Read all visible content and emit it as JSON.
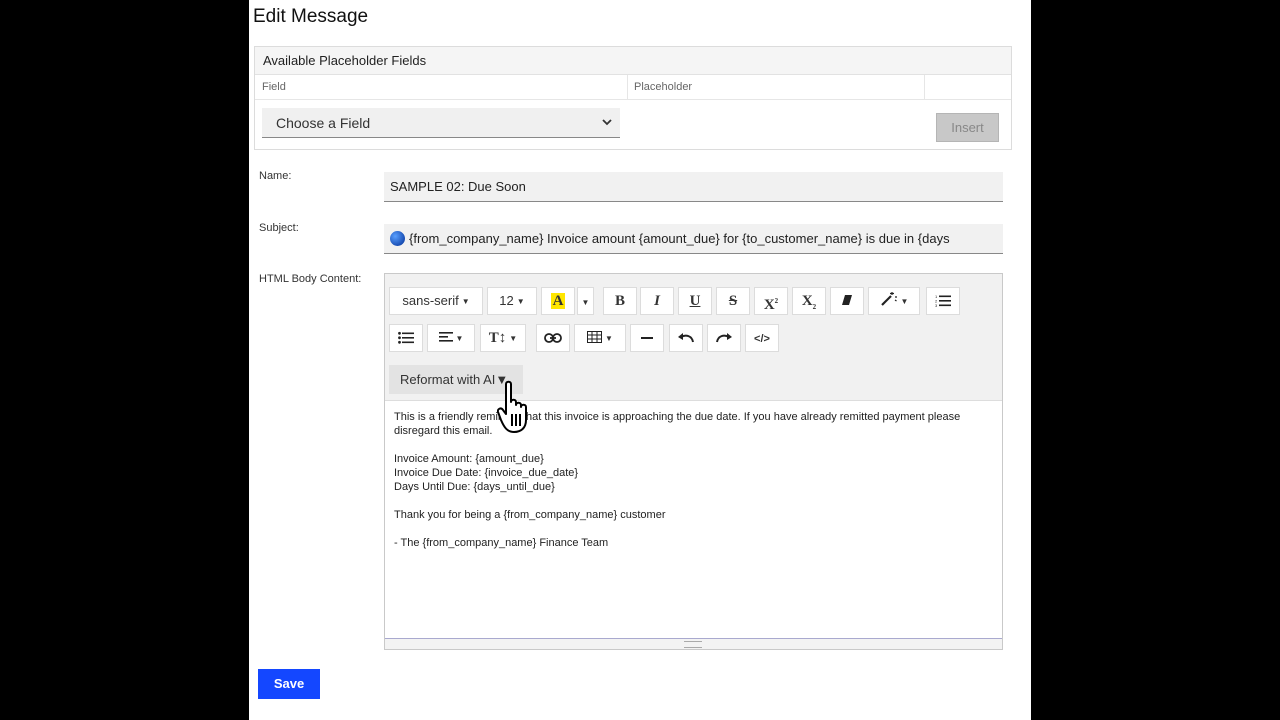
{
  "page_title": "Edit Message",
  "placeholder_panel": {
    "title": "Available Placeholder Fields",
    "columns": [
      "Field",
      "Placeholder"
    ],
    "select_value": "Choose a Field",
    "insert_label": "Insert"
  },
  "form": {
    "name_label": "Name:",
    "name_value": "SAMPLE 02: Due Soon",
    "subject_label": "Subject:",
    "subject_value": "{from_company_name} Invoice amount {amount_due} for {to_customer_name} is due in {days",
    "body_label": "HTML Body Content:"
  },
  "toolbar": {
    "font_family": "sans-serif",
    "font_size": "12",
    "reformat_label": "Reformat with AI"
  },
  "body": {
    "lines": [
      "This is a friendly reminder that this invoice is approaching the due date. If you have already remitted payment please disregard this email.",
      "Invoice Amount: {amount_due}",
      "Invoice Due Date: {invoice_due_date}",
      "Days Until Due: {days_until_due}",
      "Thank you for being a {from_company_name} customer",
      "- The {from_company_name} Finance Team"
    ]
  },
  "save_label": "Save",
  "colors": {
    "save_button": "#1447ff",
    "background": "#000000"
  }
}
